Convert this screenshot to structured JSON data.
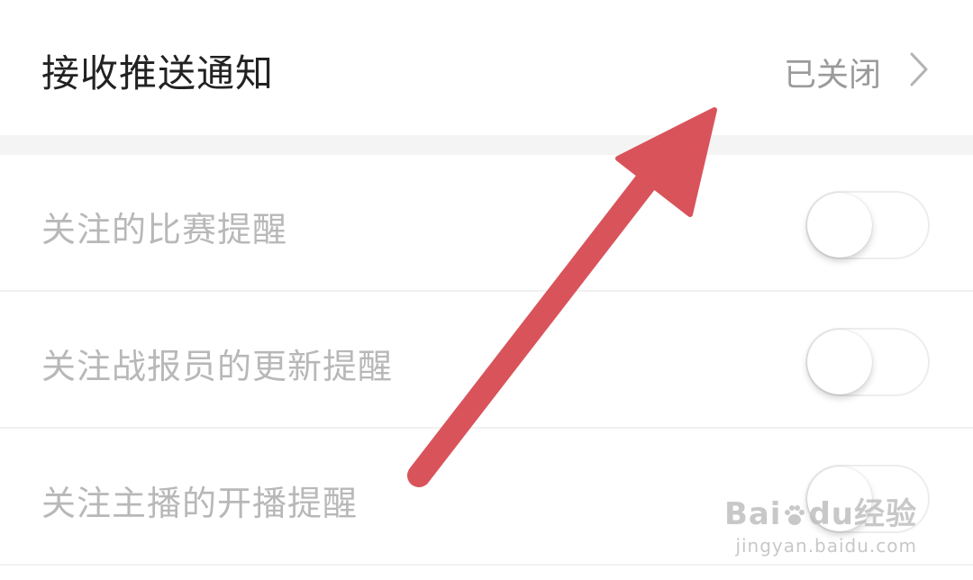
{
  "push_setting": {
    "label": "接收推送通知",
    "status": "已关闭"
  },
  "settings": [
    {
      "label": "关注的比赛提醒",
      "enabled": false
    },
    {
      "label": "关注战报员的更新提醒",
      "enabled": false
    },
    {
      "label": "关注主播的开播提醒",
      "enabled": false
    }
  ],
  "watermark": {
    "brand_a": "Bai",
    "brand_b": "du",
    "brand_c": "经验",
    "url": "jingyan.baidu.com"
  },
  "colors": {
    "arrow": "#d9535b",
    "primary_text": "#222222",
    "disabled_text": "#b8b8b8",
    "status_text": "#9a9a9a"
  }
}
